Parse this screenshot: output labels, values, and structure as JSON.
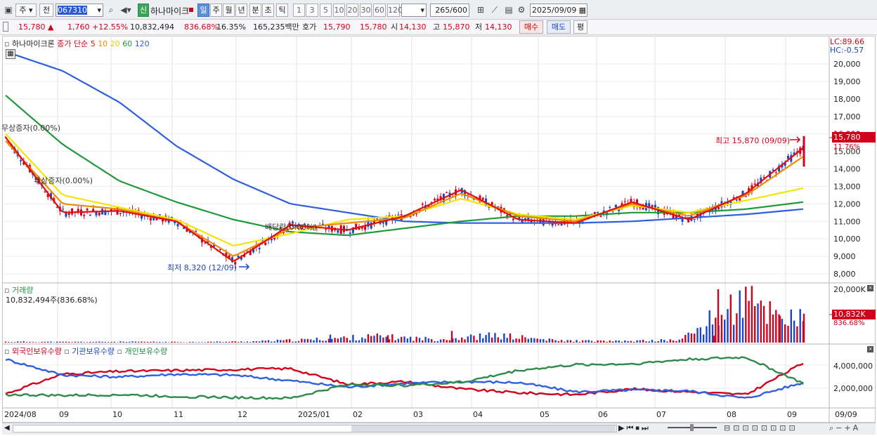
{
  "toolbar": {
    "menu_label": "주",
    "prev_label": "전",
    "code": "067310",
    "tag_label": "신",
    "name": "하나마이크",
    "periods": [
      "일",
      "주",
      "월",
      "년",
      "분",
      "초",
      "틱"
    ],
    "intervals": [
      "1",
      "3",
      "5",
      "10",
      "20",
      "30",
      "60",
      "120"
    ],
    "count": "265",
    "count_total": "/600",
    "date": "2025/09/09"
  },
  "quote": {
    "price": "15,780 ▲",
    "change": "1,760",
    "change_pct": "+12.55%",
    "volume": "10,832,494",
    "volume_ratio": "836.68%",
    "turnover": "16.35%",
    "amount": "165,235백만",
    "ask_label": "호가",
    "ask": "15,790",
    "bid": "15,780",
    "open_label": "시",
    "open": "14,130",
    "high_label": "고",
    "high": "15,870",
    "low_label": "저",
    "low": "14,130",
    "buy_label": "매수",
    "sell_label": "매도",
    "eval_label": "평"
  },
  "price_panel": {
    "name": "하나마이크론",
    "legend_label": "종가 단순",
    "ma_periods": [
      "5",
      "10",
      "20",
      "60",
      "120"
    ],
    "lc": "LC:89.66",
    "hc": "HC:-0.57",
    "y_ticks": [
      "20,000",
      "19,000",
      "18,000",
      "17,000",
      "16,000",
      "15,000",
      "14,000",
      "13,000",
      "12,000",
      "11,000",
      "10,000",
      "9,000",
      "8,000"
    ],
    "current_tag": "15,780",
    "current_pct": "11.76%",
    "high_note": "최고 15,870 (09/09)",
    "low_note": "최저 8,320 (12/09)",
    "event1": "무상증자(0.00%)",
    "event2": "무상증자(0.00%)",
    "event3": "배당락(0.00%)"
  },
  "volume_panel": {
    "title": "거래량",
    "value": "10,832,494주(836.68%)",
    "y_top": "20,000K",
    "current_tag": "10,832K",
    "current_pct": "836.68%"
  },
  "holding_panel": {
    "legend": [
      "외국인보유수량",
      "기관보유수량",
      "개인보유수량"
    ],
    "y_ticks": [
      "4,000,000",
      "2,000,000"
    ]
  },
  "x_axis": {
    "labels": [
      "2024/08",
      "09",
      "10",
      "11",
      "12",
      "2025/01",
      "02",
      "03",
      "04",
      "05",
      "06",
      "07",
      "08",
      "09"
    ],
    "right_label": "09/09"
  },
  "colors": {
    "up": "#d0021b",
    "down": "#1a46c6",
    "ma5": "#e01010",
    "ma10": "#f08a00",
    "ma20": "#f2e600",
    "ma60": "#1e9a3a",
    "ma120": "#2f5fe0"
  },
  "chart_data": [
    {
      "type": "line",
      "title": "하나마이크론",
      "x": [
        "2024/08",
        "09",
        "10",
        "11",
        "12",
        "2025/01",
        "02",
        "03",
        "04",
        "05",
        "06",
        "07",
        "08",
        "09"
      ],
      "series": [
        {
          "name": "5",
          "values": [
            15800,
            11500,
            11600,
            11000,
            8700,
            10800,
            10500,
            11300,
            12800,
            11100,
            10900,
            12100,
            11100,
            12600,
            15200
          ]
        },
        {
          "name": "10",
          "values": [
            15600,
            12000,
            11700,
            11000,
            9000,
            10600,
            10900,
            11200,
            12600,
            11300,
            11000,
            12000,
            11300,
            12500,
            14700
          ]
        },
        {
          "name": "20",
          "values": [
            16000,
            12500,
            11800,
            11100,
            9600,
            10300,
            11100,
            11300,
            12300,
            11400,
            11100,
            11900,
            11500,
            12200,
            12900
          ]
        },
        {
          "name": "60",
          "values": [
            18200,
            15400,
            13300,
            12100,
            11100,
            10400,
            10200,
            10600,
            11000,
            11300,
            11300,
            11500,
            11500,
            11700,
            12100
          ]
        },
        {
          "name": "120",
          "values": [
            20700,
            19600,
            17800,
            15300,
            13400,
            12000,
            11500,
            11000,
            10900,
            10900,
            10900,
            11000,
            11200,
            11400,
            11700
          ]
        }
      ],
      "ylim": [
        7600,
        21200
      ]
    },
    {
      "type": "bar",
      "title": "거래량",
      "categories": [
        "2024/08",
        "09",
        "10",
        "11",
        "12",
        "2025/01",
        "02",
        "03",
        "04",
        "05",
        "06",
        "07",
        "08",
        "09"
      ],
      "values": [
        450,
        350,
        400,
        300,
        550,
        1500,
        3000,
        1700,
        3500,
        1000,
        700,
        1300,
        20000,
        10832
      ],
      "ylim": [
        0,
        20000
      ]
    },
    {
      "type": "line",
      "title": "외국인보유수량 · 기관보유수량 · 개인보유수량",
      "x": [
        "2024/08",
        "09",
        "10",
        "11",
        "12",
        "2025/01",
        "02",
        "03",
        "04",
        "05",
        "06",
        "07",
        "08",
        "09"
      ],
      "series": [
        {
          "name": "외국인보유수량",
          "values": [
            1300,
            3400,
            3700,
            3800,
            3900,
            4000,
            2300,
            2600,
            1800,
            1400,
            1200,
            1800,
            1500,
            1200,
            4600
          ]
        },
        {
          "name": "기관보유수량",
          "values": [
            5000,
            3300,
            3100,
            3400,
            3300,
            2700,
            2000,
            2400,
            2600,
            2500,
            1500,
            1700,
            1600,
            800,
            2500
          ]
        },
        {
          "name": "개인보유수량",
          "values": [
            1200,
            1100,
            1200,
            1000,
            900,
            800,
            2300,
            2200,
            2500,
            3800,
            4400,
            4500,
            5000,
            5200,
            2400
          ]
        }
      ],
      "ylim": [
        0,
        5500
      ]
    }
  ]
}
